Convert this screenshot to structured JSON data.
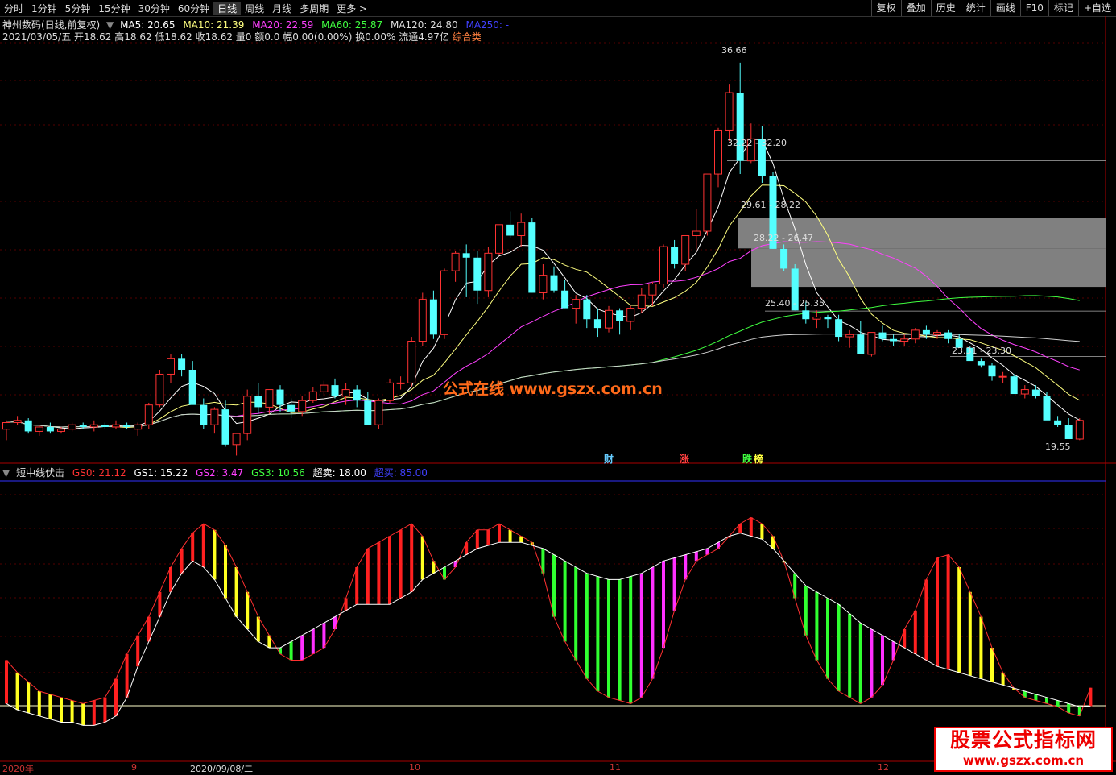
{
  "toolbar": {
    "timeframes": [
      "分时",
      "1分钟",
      "5分钟",
      "15分钟",
      "30分钟",
      "60分钟",
      "日线",
      "周线",
      "月线",
      "多周期",
      "更多 >"
    ],
    "active": "日线",
    "right_tabs": [
      "复权",
      "叠加",
      "历史",
      "统计",
      "画线",
      "F10",
      "标记",
      "+自选"
    ]
  },
  "info": {
    "stock_name": "神州数码(日线,前复权)",
    "ma5": "MA5: 20.65",
    "ma10": "MA10: 21.39",
    "ma20": "MA20: 22.59",
    "ma60": "MA60: 25.87",
    "ma120": "MA120: 24.80",
    "ma250": "MA250: -",
    "date": "2021/03/05/五",
    "open": "开18.62",
    "high": "高18.62",
    "low": "低18.62",
    "close": "收18.62",
    "volume": "量0",
    "amount": "额0.0",
    "change": "幅0.00(0.00%)",
    "turnover": "换0.00%",
    "float_cap": "流通4.97亿",
    "sector": "综合类"
  },
  "indicator": {
    "name": "短中线伏击",
    "gs0": "GS0: 21.12",
    "gs1": "GS1: 15.22",
    "gs2": "GS2: 3.47",
    "gs3": "GS3: 10.56",
    "oversold": "超卖: 18.00",
    "overbought": "超买: 85.00"
  },
  "annotations": {
    "high_label": "36.66",
    "low_label": "19.55",
    "gap1": "32.22 - 32.20",
    "gap2": "29.61 - 28.22",
    "gap3": "28.22 - 26.47",
    "gap4": "25.40 - 25.35",
    "gap5": "23.31 - 23.30",
    "tag_cai": "财",
    "tag_zhang": "涨",
    "tag_die": "跌",
    "tag_bang": "榜"
  },
  "watermark": "公式在线  www.gszx.com.cn",
  "logo": {
    "line1": "股票公式指标网",
    "line2": "www.gszx.com.cn"
  },
  "xaxis": {
    "labels": [
      "2020年",
      "9",
      "2020/09/08/二",
      "10",
      "11",
      "12"
    ]
  },
  "colors": {
    "up": "#ff3232",
    "down": "#54ffff",
    "ma5": "#ffffff",
    "ma10": "#ffff80",
    "ma20": "#ff40ff",
    "ma60": "#40ff40",
    "ma120": "#d0d0d0"
  },
  "chart_data": [
    {
      "type": "candlestick",
      "title": "神州数码(日线,前复权)",
      "candles": [
        [
          20.0,
          20.4,
          19.5,
          20.3
        ],
        [
          20.3,
          20.6,
          20.2,
          20.4
        ],
        [
          20.4,
          20.5,
          19.8,
          19.9
        ],
        [
          19.9,
          20.2,
          19.7,
          20.1
        ],
        [
          20.1,
          20.3,
          19.8,
          19.9
        ],
        [
          19.9,
          20.1,
          19.8,
          20.0
        ],
        [
          20.0,
          20.3,
          19.9,
          20.2
        ],
        [
          20.2,
          20.3,
          20.0,
          20.1
        ],
        [
          20.1,
          20.4,
          19.9,
          20.2
        ],
        [
          20.2,
          20.3,
          20.0,
          20.1
        ],
        [
          20.1,
          20.4,
          20.0,
          20.2
        ],
        [
          20.2,
          20.3,
          20.0,
          20.1
        ],
        [
          20.0,
          20.3,
          19.7,
          20.2
        ],
        [
          20.2,
          21.2,
          20.0,
          21.1
        ],
        [
          21.1,
          22.7,
          21.0,
          22.5
        ],
        [
          22.5,
          23.4,
          22.1,
          23.2
        ],
        [
          23.2,
          23.4,
          22.4,
          22.7
        ],
        [
          22.7,
          23.1,
          21.4,
          21.1
        ],
        [
          21.1,
          21.4,
          20.0,
          20.2
        ],
        [
          20.2,
          21.0,
          19.8,
          20.9
        ],
        [
          20.9,
          21.3,
          19.2,
          19.3
        ],
        [
          19.3,
          19.8,
          18.8,
          19.8
        ],
        [
          19.8,
          21.8,
          19.5,
          21.5
        ],
        [
          21.5,
          22.1,
          20.7,
          21.0
        ],
        [
          21.0,
          21.8,
          20.7,
          21.8
        ],
        [
          21.8,
          22.0,
          20.8,
          21.1
        ],
        [
          21.1,
          21.4,
          20.5,
          20.8
        ],
        [
          20.8,
          21.5,
          20.6,
          21.3
        ],
        [
          21.3,
          21.9,
          21.2,
          21.7
        ],
        [
          21.7,
          22.2,
          21.5,
          22.0
        ],
        [
          22.0,
          22.3,
          21.4,
          21.5
        ],
        [
          21.5,
          22.1,
          21.1,
          21.8
        ],
        [
          21.8,
          22.0,
          21.0,
          21.3
        ],
        [
          21.3,
          21.7,
          20.2,
          20.2
        ],
        [
          20.2,
          21.4,
          20.0,
          21.3
        ],
        [
          21.3,
          22.3,
          21.2,
          22.1
        ],
        [
          22.1,
          22.4,
          21.8,
          22.1
        ],
        [
          22.1,
          24.2,
          21.9,
          24.0
        ],
        [
          24.0,
          26.2,
          23.8,
          25.9
        ],
        [
          25.9,
          26.3,
          24.1,
          24.3
        ],
        [
          24.3,
          27.3,
          24.1,
          27.2
        ],
        [
          27.2,
          28.1,
          26.7,
          28.0
        ],
        [
          28.0,
          28.4,
          26.0,
          27.8
        ],
        [
          27.8,
          28.1,
          25.7,
          26.3
        ],
        [
          26.3,
          28.3,
          26.0,
          28.0
        ],
        [
          28.0,
          29.3,
          27.9,
          29.3
        ],
        [
          29.3,
          29.9,
          28.7,
          28.8
        ],
        [
          28.8,
          29.8,
          28.3,
          29.4
        ],
        [
          29.4,
          29.6,
          26.2,
          26.2
        ],
        [
          26.2,
          27.5,
          25.9,
          27.0
        ],
        [
          27.0,
          27.4,
          26.2,
          26.3
        ],
        [
          26.3,
          26.8,
          25.5,
          25.5
        ],
        [
          25.5,
          26.1,
          24.8,
          25.9
        ],
        [
          25.9,
          26.1,
          24.6,
          25.0
        ],
        [
          25.0,
          25.5,
          24.2,
          24.6
        ],
        [
          24.6,
          25.6,
          24.4,
          25.4
        ],
        [
          25.4,
          25.5,
          24.3,
          24.9
        ],
        [
          24.9,
          25.6,
          24.5,
          25.5
        ],
        [
          25.5,
          26.4,
          25.3,
          26.1
        ],
        [
          26.1,
          26.7,
          25.6,
          26.6
        ],
        [
          26.6,
          28.4,
          26.4,
          28.3
        ],
        [
          28.3,
          28.6,
          27.3,
          27.5
        ],
        [
          27.5,
          28.8,
          27.2,
          28.8
        ],
        [
          28.8,
          30.0,
          28.2,
          29.0
        ],
        [
          29.0,
          31.6,
          28.8,
          31.6
        ],
        [
          31.6,
          33.7,
          31.0,
          33.6
        ],
        [
          33.6,
          35.7,
          33.1,
          35.3
        ],
        [
          35.3,
          36.66,
          31.6,
          32.2
        ],
        [
          32.2,
          33.9,
          32.1,
          33.2
        ],
        [
          33.2,
          33.8,
          31.2,
          31.5
        ],
        [
          31.5,
          31.7,
          28.2,
          28.2
        ],
        [
          28.2,
          28.4,
          27.2,
          27.3
        ],
        [
          27.3,
          27.5,
          25.4,
          25.4
        ],
        [
          25.4,
          25.8,
          24.8,
          25.0
        ],
        [
          25.0,
          25.4,
          24.6,
          25.1
        ],
        [
          25.1,
          25.2,
          24.6,
          25.0
        ],
        [
          25.0,
          25.2,
          24.0,
          24.2
        ],
        [
          24.2,
          24.5,
          23.7,
          24.3
        ],
        [
          24.3,
          24.9,
          23.5,
          23.4
        ],
        [
          23.4,
          24.4,
          23.3,
          24.4
        ],
        [
          24.4,
          24.7,
          24.0,
          24.1
        ],
        [
          24.1,
          24.3,
          23.8,
          24.0
        ],
        [
          24.0,
          24.3,
          23.8,
          24.1
        ],
        [
          24.1,
          24.6,
          23.9,
          24.5
        ],
        [
          24.5,
          24.7,
          24.1,
          24.3
        ],
        [
          24.3,
          24.5,
          24.1,
          24.4
        ],
        [
          24.4,
          24.5,
          23.9,
          24.1
        ],
        [
          24.1,
          24.3,
          23.8,
          23.7
        ],
        [
          23.7,
          23.8,
          23.2,
          23.1
        ],
        [
          23.1,
          23.2,
          22.8,
          22.9
        ],
        [
          22.9,
          23.0,
          22.2,
          22.4
        ],
        [
          22.4,
          22.6,
          22.1,
          22.4
        ],
        [
          22.4,
          22.5,
          21.6,
          21.6
        ],
        [
          21.6,
          22.0,
          21.4,
          21.8
        ],
        [
          21.8,
          22.0,
          21.4,
          21.5
        ],
        [
          21.5,
          21.7,
          20.6,
          20.4
        ],
        [
          20.4,
          20.6,
          20.1,
          20.2
        ],
        [
          20.2,
          20.5,
          19.7,
          19.55
        ],
        [
          19.55,
          20.5,
          19.5,
          20.4
        ]
      ],
      "ma_series": [
        "MA5",
        "MA10",
        "MA20",
        "MA60",
        "MA120"
      ]
    },
    {
      "type": "bar",
      "title": "短中线伏击",
      "ylim": [
        0,
        100
      ],
      "hlines": [
        {
          "name": "超卖",
          "value": 18
        },
        {
          "name": "超买",
          "value": 85
        }
      ],
      "gs0": [
        30,
        26,
        23,
        20,
        19,
        18,
        17,
        16,
        17,
        18,
        24,
        32,
        38,
        44,
        52,
        60,
        66,
        71,
        74,
        72,
        67,
        60,
        52,
        44,
        38,
        32,
        30,
        30,
        32,
        34,
        40,
        50,
        60,
        66,
        68,
        70,
        72,
        74,
        70,
        62,
        56,
        60,
        68,
        72,
        72,
        74,
        72,
        70,
        68,
        58,
        44,
        36,
        30,
        24,
        20,
        18,
        17,
        16,
        18,
        24,
        34,
        46,
        56,
        62,
        64,
        66,
        70,
        74,
        76,
        74,
        70,
        62,
        50,
        38,
        30,
        24,
        20,
        18,
        16,
        18,
        22,
        30,
        40,
        46,
        56,
        63,
        64,
        60,
        52,
        44,
        34,
        26,
        21,
        18,
        17,
        16,
        15,
        13,
        12,
        21.12
      ],
      "gs1": [
        16,
        14,
        13,
        12,
        11,
        10,
        10,
        9,
        9,
        10,
        12,
        18,
        28,
        36,
        44,
        52,
        58,
        62,
        60,
        56,
        50,
        44,
        40,
        36,
        34,
        34,
        36,
        38,
        40,
        42,
        44,
        46,
        48,
        48,
        48,
        48,
        50,
        52,
        56,
        58,
        60,
        62,
        64,
        66,
        67,
        68,
        68,
        68,
        67,
        66,
        64,
        62,
        60,
        58,
        57,
        56,
        56,
        57,
        58,
        60,
        62,
        63,
        64,
        65,
        66,
        68,
        70,
        71,
        70,
        69,
        66,
        62,
        58,
        54,
        52,
        50,
        48,
        45,
        42,
        40,
        38,
        36,
        34,
        32,
        30,
        28,
        27,
        26,
        25,
        24,
        23,
        22,
        21,
        20,
        19,
        18,
        17,
        16,
        15,
        15.22
      ]
    }
  ]
}
